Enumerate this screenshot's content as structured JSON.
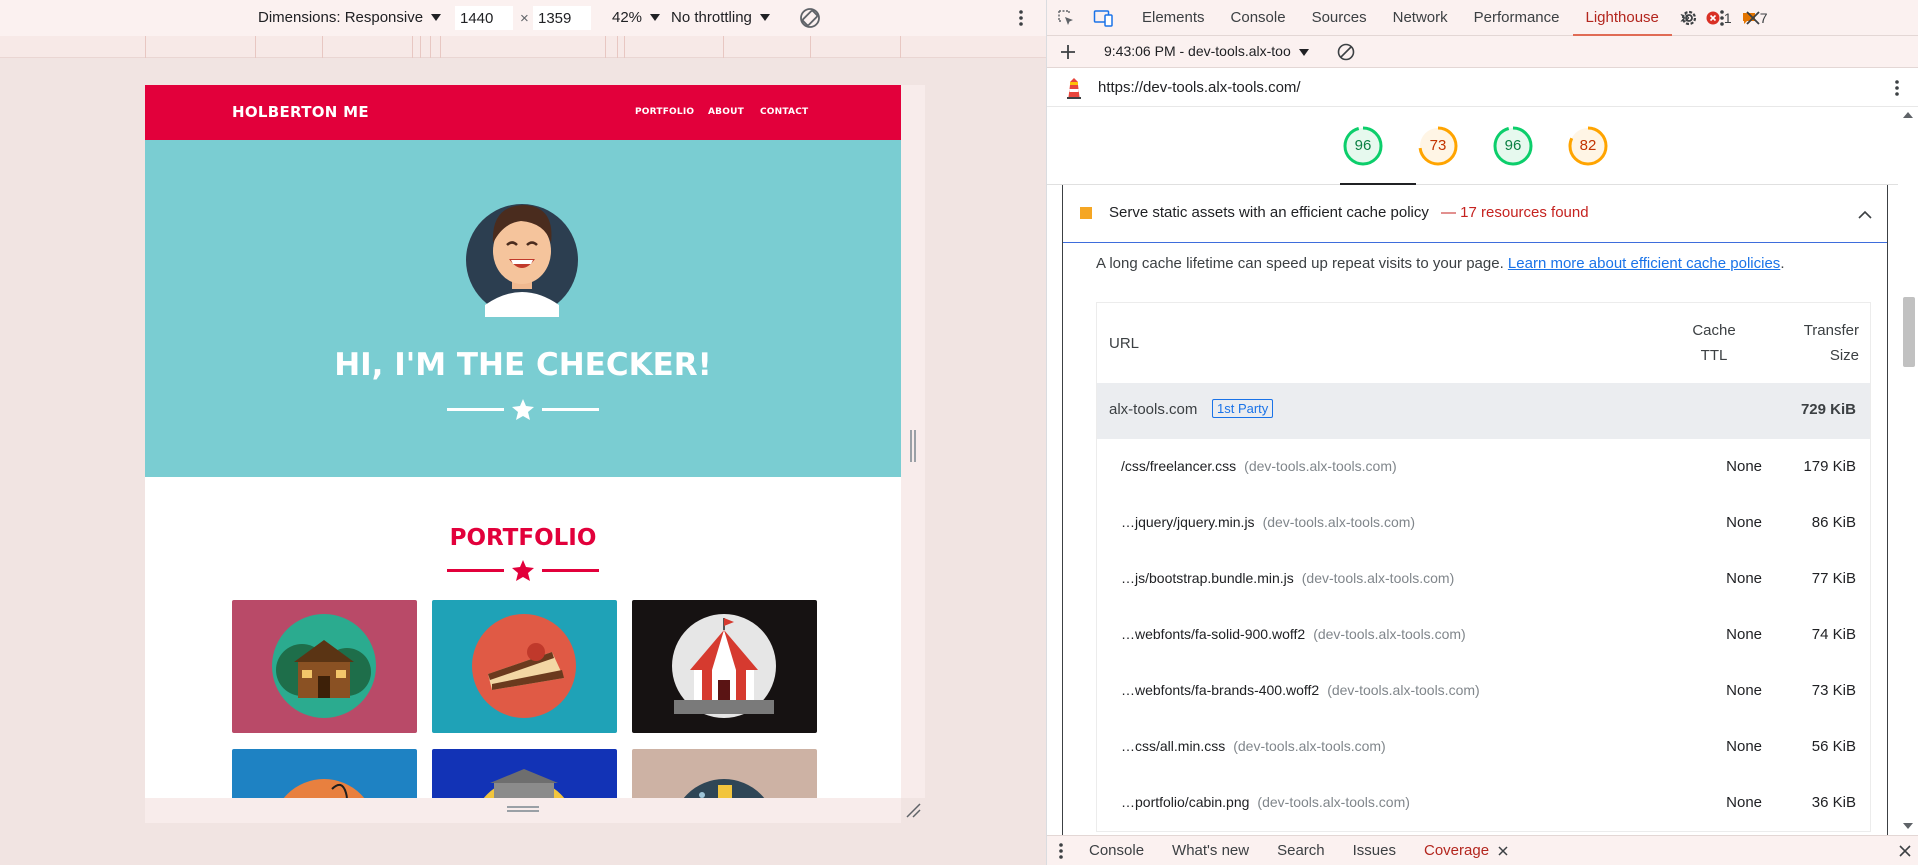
{
  "device_toolbar": {
    "dimensions_label": "Dimensions: Responsive",
    "width_value": "1440",
    "times": "×",
    "height_value": "1359",
    "zoom_label": "42%",
    "throttle_label": "No throttling"
  },
  "site": {
    "brand": "HOLBERTON ME",
    "nav": [
      "PORTFOLIO",
      "ABOUT",
      "CONTACT"
    ],
    "hero_title": "HI, I'M THE CHECKER!",
    "portfolio_title": "PORTFOLIO",
    "colors": {
      "nav": "#e2003b",
      "hero": "#7acdd2"
    },
    "tiles": [
      {
        "name": "cabin",
        "color": "#b94a68"
      },
      {
        "name": "cake",
        "color": "#1fa2b7"
      },
      {
        "name": "circus",
        "color": "#161212"
      },
      {
        "name": "game",
        "color": "#1e82c3"
      },
      {
        "name": "safe",
        "color": "#1233b6"
      },
      {
        "name": "submarine",
        "color": "#cdb2a4"
      }
    ]
  },
  "devtools": {
    "tabs": [
      "Elements",
      "Console",
      "Sources",
      "Network",
      "Performance",
      "Lighthouse"
    ],
    "active_tab": "Lighthouse",
    "error_count": "1",
    "message_count": "7",
    "report_selector": "9:43:06 PM - dev-tools.alx-too",
    "url": "https://dev-tools.alx-tools.com/",
    "scores": [
      {
        "value": "96",
        "level": "pass",
        "color": "#0cce6b"
      },
      {
        "value": "73",
        "level": "average",
        "color": "#ffa400"
      },
      {
        "value": "96",
        "level": "pass",
        "color": "#0cce6b"
      },
      {
        "value": "82",
        "level": "average",
        "color": "#ffa400"
      }
    ],
    "audit": {
      "title": "Serve static assets with an efficient cache policy",
      "found": "— 17 resources found",
      "description": "A long cache lifetime can speed up repeat visits to your page.",
      "link_text": "Learn more about efficient cache policies",
      "after_link": ".",
      "headers": {
        "url": "URL",
        "ttl_line1": "Cache",
        "ttl_line2": "TTL",
        "size_line1": "Transfer",
        "size_line2": "Size"
      },
      "group": {
        "host": "alx-tools.com",
        "badge": "1st Party",
        "size": "729 KiB"
      },
      "rows": [
        {
          "path": "/css/freelancer.css",
          "host": "(dev-tools.alx-tools.com)",
          "ttl": "None",
          "size": "179 KiB"
        },
        {
          "path": "…jquery/jquery.min.js",
          "host": "(dev-tools.alx-tools.com)",
          "ttl": "None",
          "size": "86 KiB"
        },
        {
          "path": "…js/bootstrap.bundle.min.js",
          "host": "(dev-tools.alx-tools.com)",
          "ttl": "None",
          "size": "77 KiB"
        },
        {
          "path": "…webfonts/fa-solid-900.woff2",
          "host": "(dev-tools.alx-tools.com)",
          "ttl": "None",
          "size": "74 KiB"
        },
        {
          "path": "…webfonts/fa-brands-400.woff2",
          "host": "(dev-tools.alx-tools.com)",
          "ttl": "None",
          "size": "73 KiB"
        },
        {
          "path": "…css/all.min.css",
          "host": "(dev-tools.alx-tools.com)",
          "ttl": "None",
          "size": "56 KiB"
        },
        {
          "path": "…portfolio/cabin.png",
          "host": "(dev-tools.alx-tools.com)",
          "ttl": "None",
          "size": "36 KiB"
        }
      ]
    },
    "drawer_tabs": [
      "Console",
      "What's new",
      "Search",
      "Issues",
      "Coverage"
    ],
    "active_drawer_tab": "Coverage"
  }
}
